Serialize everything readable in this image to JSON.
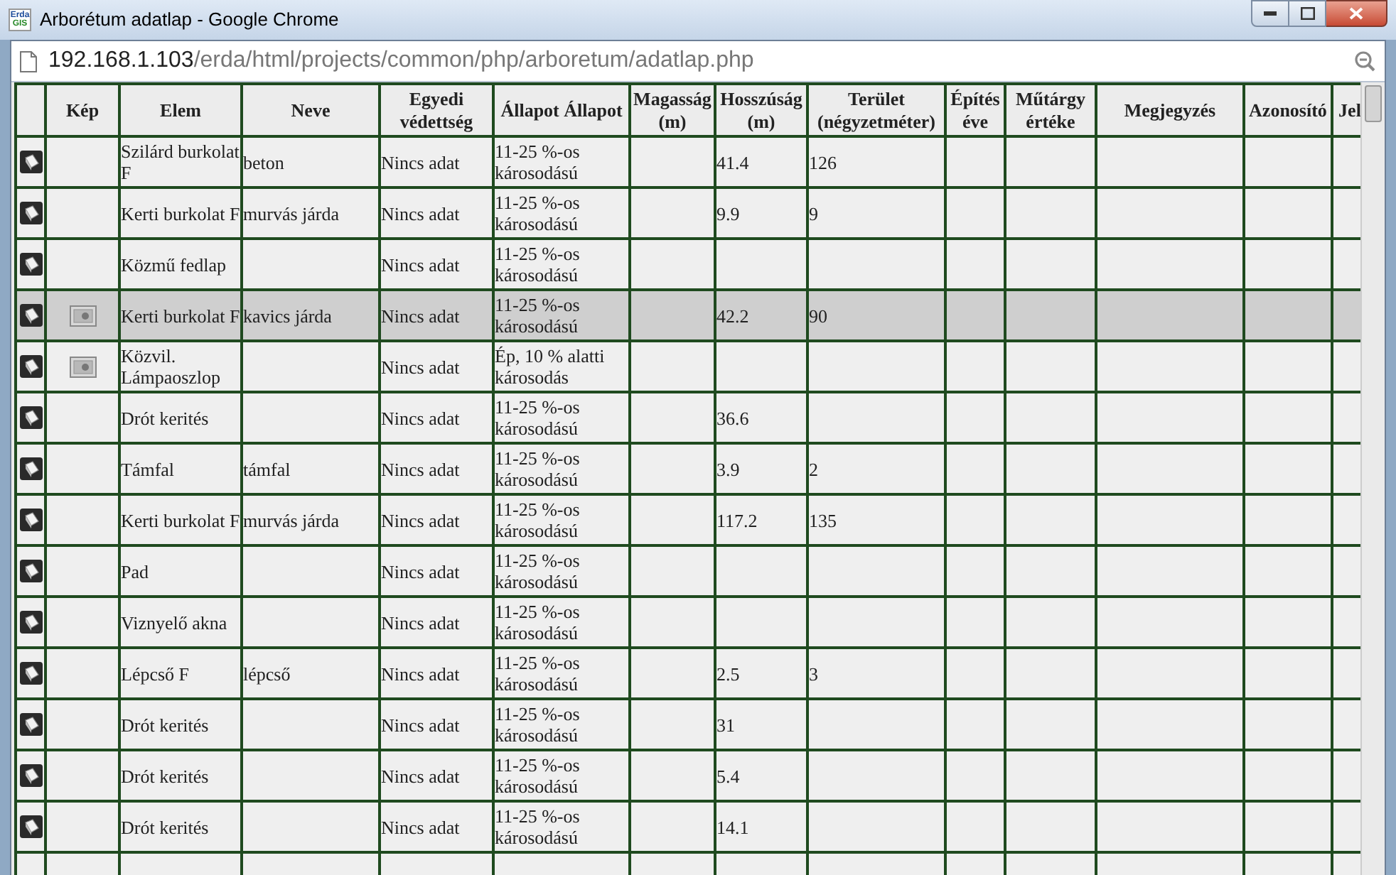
{
  "window": {
    "title": "Arborétum adatlap - Google Chrome",
    "logo": [
      "Erda",
      "GIS"
    ]
  },
  "address_bar": {
    "host": "192.168.1.103",
    "path": "/erda/html/projects/common/php/arboretum/adatlap.php"
  },
  "table": {
    "columns": [
      {
        "label": "Kép",
        "kind": "photo"
      },
      {
        "label": "Elem",
        "kind": "text"
      },
      {
        "label": "Neve",
        "kind": "text"
      },
      {
        "label": "Egyedi védettség",
        "kind": "text"
      },
      {
        "label": "Állapot Állapot",
        "kind": "text"
      },
      {
        "label": "Magasság (m)",
        "kind": "text"
      },
      {
        "label": "Hosszúság (m)",
        "kind": "text"
      },
      {
        "label": "Terület (négyzetméter)",
        "kind": "text"
      },
      {
        "label": "Építés éve",
        "kind": "text"
      },
      {
        "label": "Műtárgy értéke",
        "kind": "text"
      },
      {
        "label": "Megjegyzés",
        "kind": "text"
      },
      {
        "label": "Azonosító",
        "kind": "text"
      },
      {
        "label": "Jel",
        "kind": "text"
      }
    ],
    "rows": [
      {
        "selected": false,
        "photo": false,
        "elem": "Szilárd burkolat F",
        "neve": "beton",
        "vedettseg": "Nincs adat",
        "allapot": "11-25 %-os károsodású",
        "hossz": "41.4",
        "terulet": "126"
      },
      {
        "selected": false,
        "photo": false,
        "elem": "Kerti burkolat F",
        "neve": "murvás járda",
        "vedettseg": "Nincs adat",
        "allapot": "11-25 %-os károsodású",
        "hossz": "9.9",
        "terulet": "9"
      },
      {
        "selected": false,
        "photo": false,
        "elem": "Közmű fedlap",
        "vedettseg": "Nincs adat",
        "allapot": "11-25 %-os károsodású"
      },
      {
        "selected": true,
        "photo": true,
        "elem": "Kerti burkolat F",
        "neve": "kavics járda",
        "vedettseg": "Nincs adat",
        "allapot": "11-25 %-os károsodású",
        "hossz": "42.2",
        "terulet": "90"
      },
      {
        "selected": false,
        "photo": true,
        "elem": "Közvil. Lámpaoszlop",
        "vedettseg": "Nincs adat",
        "allapot": "Ép, 10 % alatti károsodás"
      },
      {
        "selected": false,
        "photo": false,
        "elem": "Drót kerités",
        "vedettseg": "Nincs adat",
        "allapot": "11-25 %-os károsodású",
        "hossz": "36.6"
      },
      {
        "selected": false,
        "photo": false,
        "elem": "Támfal",
        "neve": "támfal",
        "vedettseg": "Nincs adat",
        "allapot": "11-25 %-os károsodású",
        "hossz": "3.9",
        "terulet": "2"
      },
      {
        "selected": false,
        "photo": false,
        "elem": "Kerti burkolat F",
        "neve": "murvás járda",
        "vedettseg": "Nincs adat",
        "allapot": "11-25 %-os károsodású",
        "hossz": "117.2",
        "terulet": "135"
      },
      {
        "selected": false,
        "photo": false,
        "elem": "Pad",
        "vedettseg": "Nincs adat",
        "allapot": "11-25 %-os károsodású"
      },
      {
        "selected": false,
        "photo": false,
        "elem": "Viznyelő akna",
        "vedettseg": "Nincs adat",
        "allapot": "11-25 %-os károsodású"
      },
      {
        "selected": false,
        "photo": false,
        "elem": "Lépcső F",
        "neve": "lépcső",
        "vedettseg": "Nincs adat",
        "allapot": "11-25 %-os károsodású",
        "hossz": "2.5",
        "terulet": "3"
      },
      {
        "selected": false,
        "photo": false,
        "elem": "Drót kerités",
        "vedettseg": "Nincs adat",
        "allapot": "11-25 %-os károsodású",
        "hossz": "31"
      },
      {
        "selected": false,
        "photo": false,
        "elem": "Drót kerités",
        "vedettseg": "Nincs adat",
        "allapot": "11-25 %-os károsodású",
        "hossz": "5.4"
      },
      {
        "selected": false,
        "photo": false,
        "elem": "Drót kerités",
        "vedettseg": "Nincs adat",
        "allapot": "11-25 %-os károsodású",
        "hossz": "14.1"
      }
    ]
  }
}
